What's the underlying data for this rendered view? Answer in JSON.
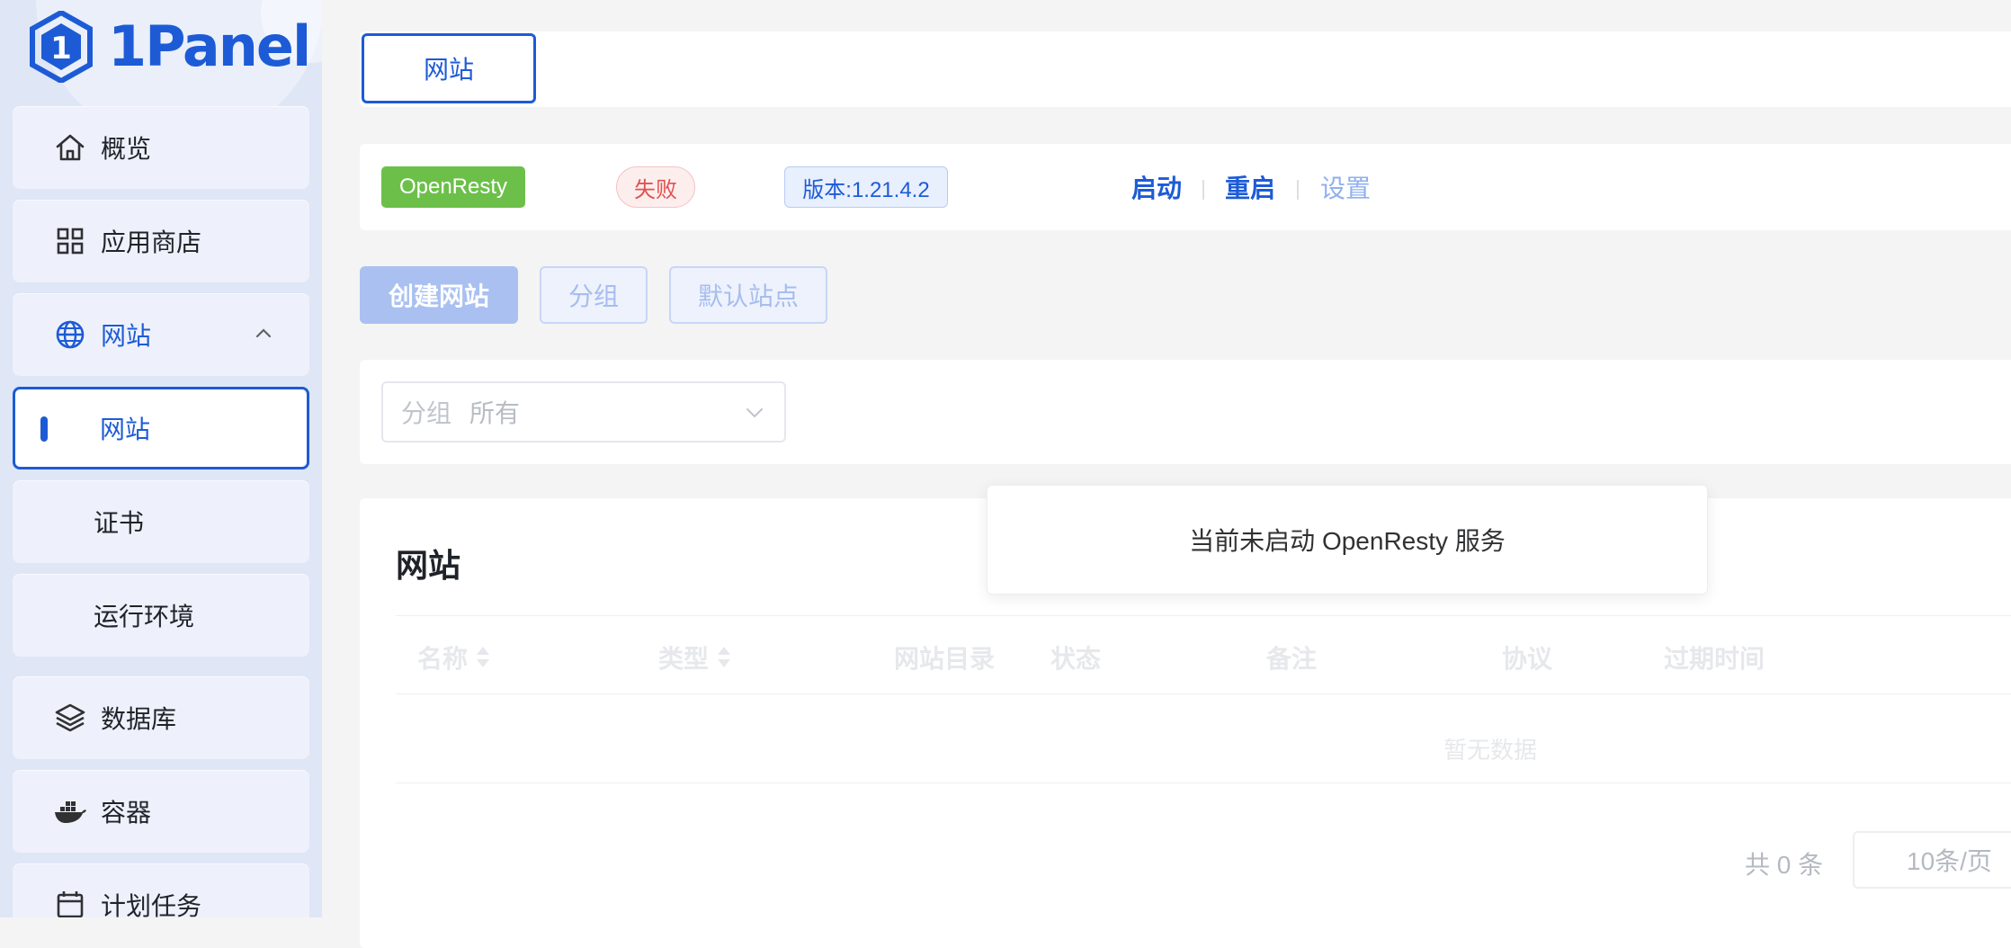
{
  "brand": {
    "name": "1Panel",
    "color": "#1d5bd6"
  },
  "sidebar": {
    "items": [
      {
        "label": "概览",
        "icon": "home-icon"
      },
      {
        "label": "应用商店",
        "icon": "apps-grid-icon"
      },
      {
        "label": "网站",
        "icon": "globe-icon",
        "expanded": true
      },
      {
        "label": "网站",
        "active": true
      },
      {
        "label": "证书"
      },
      {
        "label": "运行环境"
      },
      {
        "label": "数据库",
        "icon": "layers-icon"
      },
      {
        "label": "容器",
        "icon": "docker-icon"
      },
      {
        "label": "计划任务",
        "icon": "calendar-icon"
      }
    ]
  },
  "tabs": [
    {
      "label": "网站",
      "active": true
    }
  ],
  "status_bar": {
    "app_tag": "OpenResty",
    "status_tag": "失败",
    "version_tag": "版本:1.21.4.2",
    "actions": {
      "start": "启动",
      "restart": "重启",
      "settings": "设置"
    }
  },
  "toolbar": {
    "create_label": "创建网站",
    "group_label": "分组",
    "default_site_label": "默认站点"
  },
  "filter": {
    "label": "分组",
    "value": "所有"
  },
  "table": {
    "title": "网站",
    "columns": [
      "名称",
      "类型",
      "网站目录",
      "状态",
      "备注",
      "协议",
      "过期时间"
    ],
    "empty_text": "暂无数据",
    "pagination": {
      "total_text": "共 0 条",
      "page_size": "10条/页"
    }
  },
  "toast": {
    "message": "当前未启动 OpenResty 服务"
  }
}
